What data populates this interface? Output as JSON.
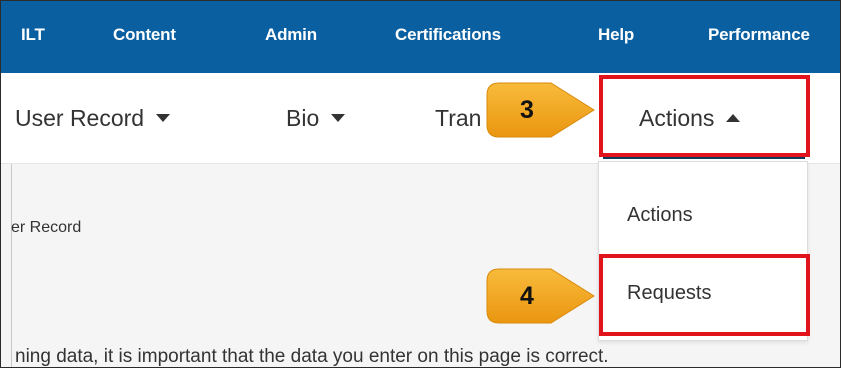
{
  "top_nav": {
    "items": [
      "ILT",
      "Content",
      "Admin",
      "Certifications",
      "Help",
      "Performance"
    ],
    "background": "#0a5fa1"
  },
  "sub_nav": {
    "user_record": "User Record",
    "bio": "Bio",
    "transcript_partial": "Tran",
    "actions": "Actions"
  },
  "dropdown": {
    "items": [
      "Actions",
      "Requests"
    ]
  },
  "content": {
    "breadcrumb_fragment": "er Record",
    "body_fragment": "ning data, it is important that the data you enter on this page is correct."
  },
  "callouts": {
    "step_3": "3",
    "step_4": "4",
    "color": "#f5a81c"
  },
  "highlight_color": "#e1141b"
}
